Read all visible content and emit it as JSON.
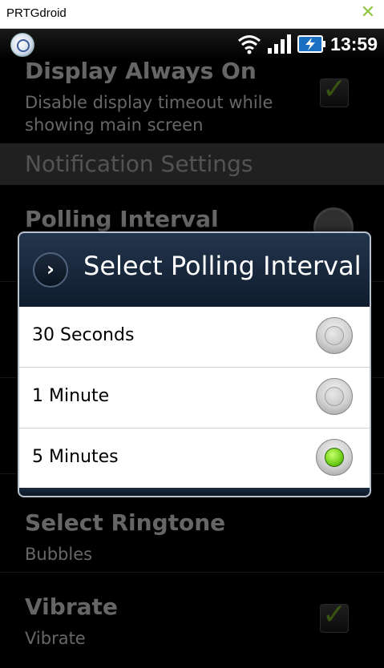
{
  "window": {
    "title": "PRTGdroid",
    "close_icon": "close-icon",
    "accent": "#8dc63f"
  },
  "statusbar": {
    "time": "13:59"
  },
  "background": {
    "display_always_on": {
      "title": "Display Always On",
      "subtitle_line1": "Disable display timeout while",
      "subtitle_line2": "showing main screen",
      "checked": true
    },
    "section_header": "Notification Settings",
    "polling_interval": {
      "title": "Polling Interval"
    },
    "select_ringtone": {
      "title": "Select Ringtone",
      "subtitle": "Bubbles"
    },
    "vibrate": {
      "title": "Vibrate",
      "subtitle": "Vibrate",
      "checked": true
    }
  },
  "dialog": {
    "title": "Select Polling Interval",
    "options": [
      {
        "label": "30 Seconds",
        "checked": false
      },
      {
        "label": "1 Minute",
        "checked": false
      },
      {
        "label": "5 Minutes",
        "checked": true
      }
    ]
  }
}
